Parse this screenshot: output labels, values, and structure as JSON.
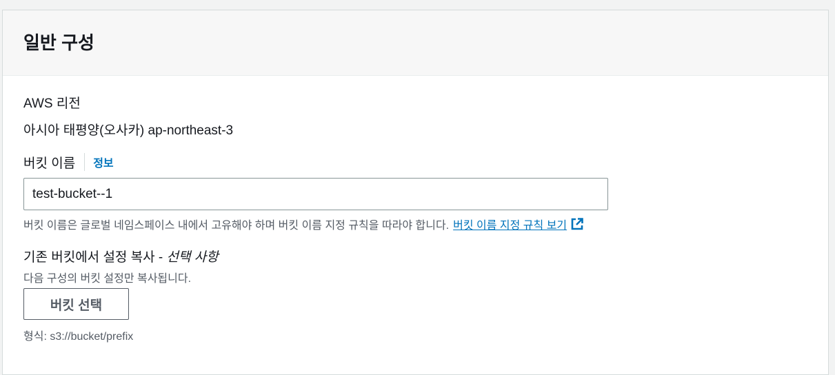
{
  "section": {
    "title": "일반 구성"
  },
  "region": {
    "label": "AWS 리전",
    "value": "아시아 태평양(오사카) ap-northeast-3"
  },
  "bucket_name": {
    "label": "버킷 이름",
    "info_link": "정보",
    "value": "test-bucket--1",
    "hint": "버킷 이름은 글로벌 네임스페이스 내에서 고유해야 하며 버킷 이름 지정 규칙을 따라야 합니다.",
    "rules_link": "버킷 이름 지정 규칙 보기",
    "rules_link_icon": "external-link-icon"
  },
  "copy_settings": {
    "label": "기존 버킷에서 설정 복사 -",
    "optional": "선택 사항",
    "description": "다음 구성의 버킷 설정만 복사됩니다.",
    "button_label": "버킷 선택",
    "format_hint": "형식: s3://bucket/prefix"
  },
  "colors": {
    "link": "#0073bb",
    "text": "#16191f",
    "secondary_text": "#545b64",
    "header_bg": "#f7f7f7"
  }
}
